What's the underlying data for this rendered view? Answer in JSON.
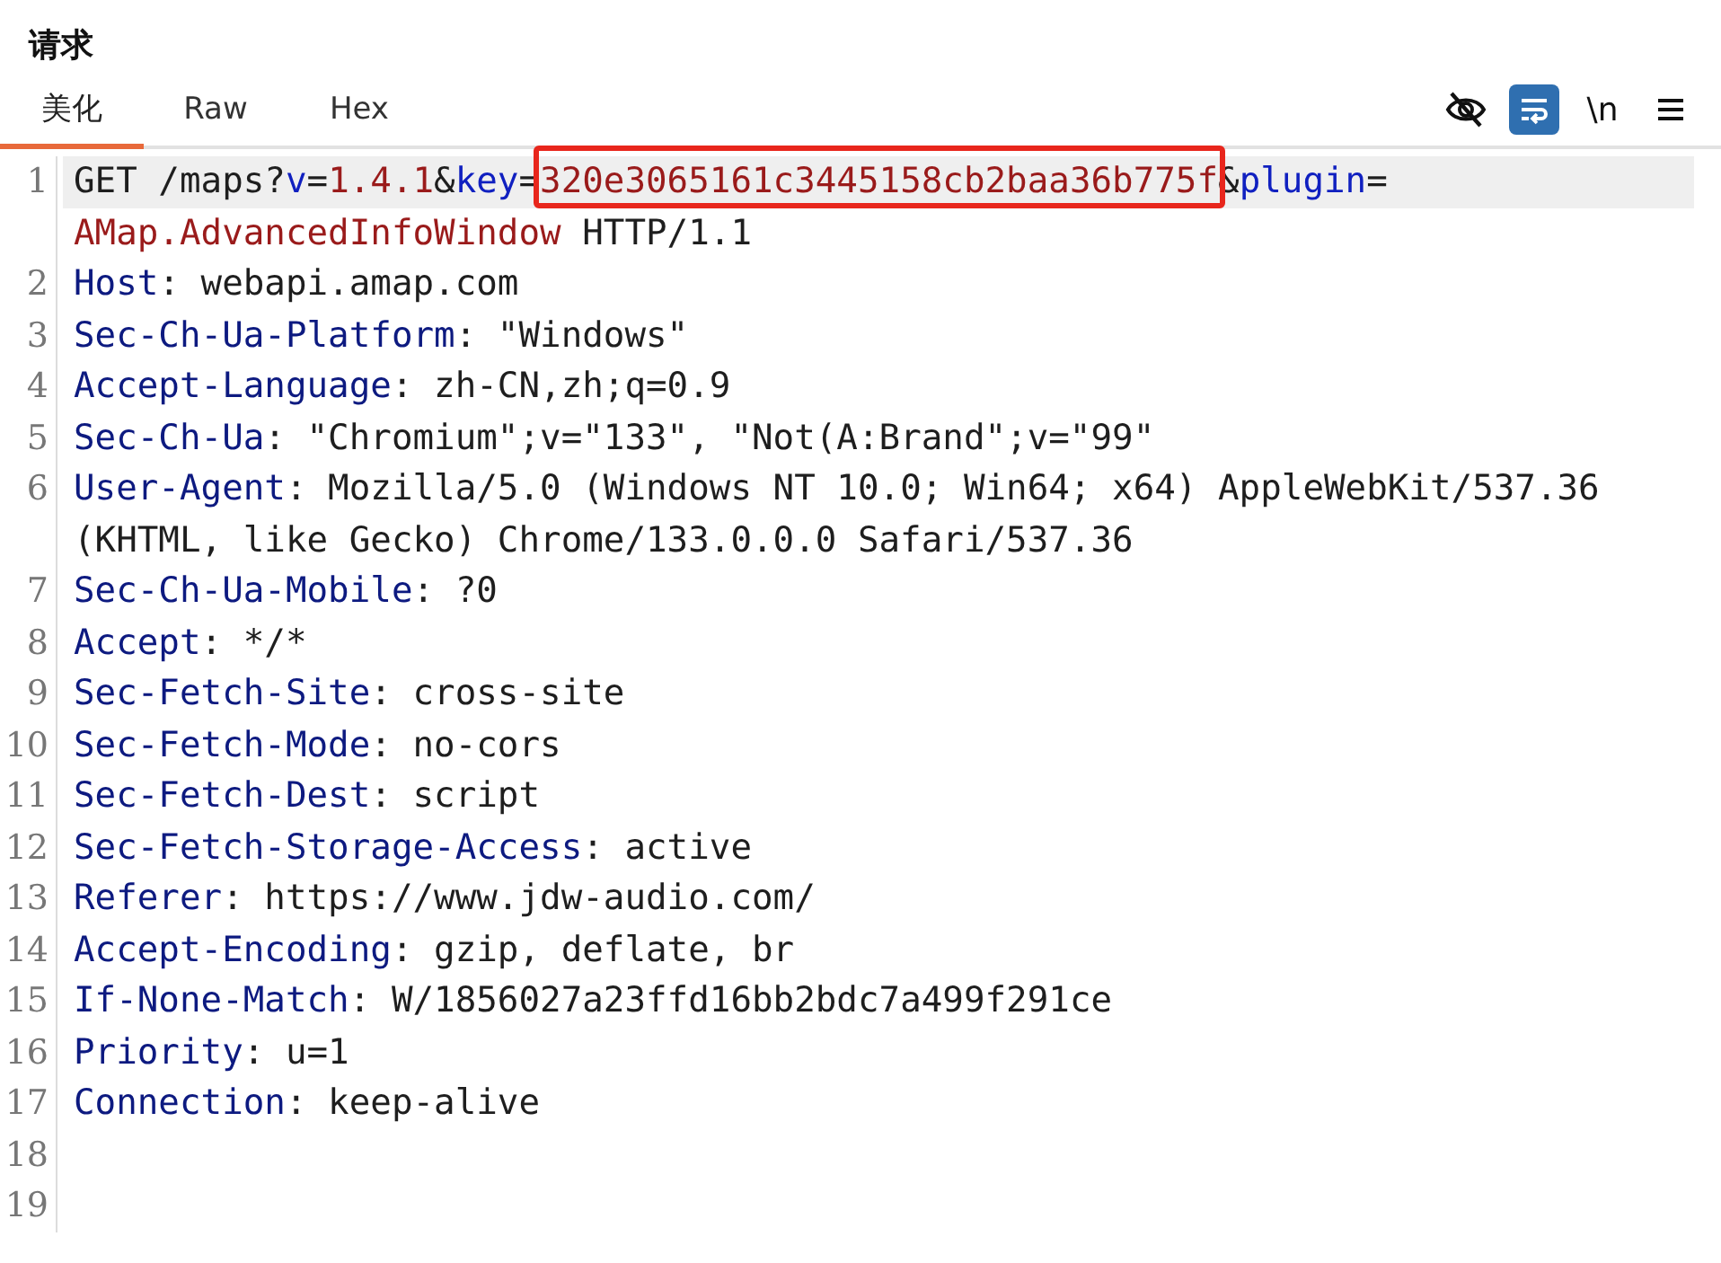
{
  "title": "请求",
  "tabs": [
    {
      "label": "美化",
      "selected": true
    },
    {
      "label": "Raw",
      "selected": false
    },
    {
      "label": "Hex",
      "selected": false
    }
  ],
  "toolbar": [
    {
      "kind": "eye-off",
      "on": false
    },
    {
      "kind": "wrap",
      "on": true
    },
    {
      "kind": "text",
      "label": "\\n",
      "on": false
    },
    {
      "kind": "menu",
      "on": false
    }
  ],
  "lines": [
    {
      "number": "1",
      "current": true,
      "rows": [
        {
          "segments": [
            {
              "kind": "plain",
              "text": "GET /maps?"
            },
            {
              "kind": "param",
              "text": "v"
            },
            {
              "kind": "plain",
              "text": "="
            },
            {
              "kind": "value",
              "text": "1.4.1"
            },
            {
              "kind": "plain",
              "text": "&"
            },
            {
              "kind": "param",
              "text": "key"
            },
            {
              "kind": "plain",
              "text": "="
            },
            {
              "kind": "value",
              "text": "320e3065161c3445158cb2baa36b775f",
              "marked": true
            },
            {
              "kind": "plain",
              "text": "&"
            },
            {
              "kind": "param",
              "text": "plugin"
            },
            {
              "kind": "plain",
              "text": "="
            }
          ]
        },
        {
          "segments": [
            {
              "kind": "value",
              "text": "AMap.AdvancedInfoWindow"
            },
            {
              "kind": "plain",
              "text": " HTTP/1.1"
            }
          ]
        }
      ]
    },
    {
      "number": "2",
      "current": false,
      "rows": [
        {
          "segments": [
            {
              "kind": "name",
              "text": "Host"
            },
            {
              "kind": "plain",
              "text": ": webapi.amap.com"
            }
          ]
        }
      ]
    },
    {
      "number": "3",
      "current": false,
      "rows": [
        {
          "segments": [
            {
              "kind": "name",
              "text": "Sec-Ch-Ua-Platform"
            },
            {
              "kind": "plain",
              "text": ": \"Windows\""
            }
          ]
        }
      ]
    },
    {
      "number": "4",
      "current": false,
      "rows": [
        {
          "segments": [
            {
              "kind": "name",
              "text": "Accept-Language"
            },
            {
              "kind": "plain",
              "text": ": zh-CN,zh;q=0.9"
            }
          ]
        }
      ]
    },
    {
      "number": "5",
      "current": false,
      "rows": [
        {
          "segments": [
            {
              "kind": "name",
              "text": "Sec-Ch-Ua"
            },
            {
              "kind": "plain",
              "text": ": \"Chromium\";v=\"133\", \"Not(A:Brand\";v=\"99\""
            }
          ]
        }
      ]
    },
    {
      "number": "6",
      "current": false,
      "rows": [
        {
          "segments": [
            {
              "kind": "name",
              "text": "User-Agent"
            },
            {
              "kind": "plain",
              "text": ": Mozilla/5.0 (Windows NT 10.0; Win64; x64) AppleWebKit/537.36"
            }
          ]
        },
        {
          "segments": [
            {
              "kind": "plain",
              "text": "(KHTML, like Gecko) Chrome/133.0.0.0 Safari/537.36"
            }
          ]
        }
      ]
    },
    {
      "number": "7",
      "current": false,
      "rows": [
        {
          "segments": [
            {
              "kind": "name",
              "text": "Sec-Ch-Ua-Mobile"
            },
            {
              "kind": "plain",
              "text": ": ?0"
            }
          ]
        }
      ]
    },
    {
      "number": "8",
      "current": false,
      "rows": [
        {
          "segments": [
            {
              "kind": "name",
              "text": "Accept"
            },
            {
              "kind": "plain",
              "text": ": */*"
            }
          ]
        }
      ]
    },
    {
      "number": "9",
      "current": false,
      "rows": [
        {
          "segments": [
            {
              "kind": "name",
              "text": "Sec-Fetch-Site"
            },
            {
              "kind": "plain",
              "text": ": cross-site"
            }
          ]
        }
      ]
    },
    {
      "number": "10",
      "current": false,
      "rows": [
        {
          "segments": [
            {
              "kind": "name",
              "text": "Sec-Fetch-Mode"
            },
            {
              "kind": "plain",
              "text": ": no-cors"
            }
          ]
        }
      ]
    },
    {
      "number": "11",
      "current": false,
      "rows": [
        {
          "segments": [
            {
              "kind": "name",
              "text": "Sec-Fetch-Dest"
            },
            {
              "kind": "plain",
              "text": ": script"
            }
          ]
        }
      ]
    },
    {
      "number": "12",
      "current": false,
      "rows": [
        {
          "segments": [
            {
              "kind": "name",
              "text": "Sec-Fetch-Storage-Access"
            },
            {
              "kind": "plain",
              "text": ": active"
            }
          ]
        }
      ]
    },
    {
      "number": "13",
      "current": false,
      "rows": [
        {
          "segments": [
            {
              "kind": "name",
              "text": "Referer"
            },
            {
              "kind": "plain",
              "text": ": https://www.jdw-audio.com/"
            }
          ]
        }
      ]
    },
    {
      "number": "14",
      "current": false,
      "rows": [
        {
          "segments": [
            {
              "kind": "name",
              "text": "Accept-Encoding"
            },
            {
              "kind": "plain",
              "text": ": gzip, deflate, br"
            }
          ]
        }
      ]
    },
    {
      "number": "15",
      "current": false,
      "rows": [
        {
          "segments": [
            {
              "kind": "name",
              "text": "If-None-Match"
            },
            {
              "kind": "plain",
              "text": ": W/1856027a23ffd16bb2bdc7a499f291ce"
            }
          ]
        }
      ]
    },
    {
      "number": "16",
      "current": false,
      "rows": [
        {
          "segments": [
            {
              "kind": "name",
              "text": "Priority"
            },
            {
              "kind": "plain",
              "text": ": u=1"
            }
          ]
        }
      ]
    },
    {
      "number": "17",
      "current": false,
      "rows": [
        {
          "segments": [
            {
              "kind": "name",
              "text": "Connection"
            },
            {
              "kind": "plain",
              "text": ": keep-alive"
            }
          ]
        }
      ]
    },
    {
      "number": "18",
      "current": false
    },
    {
      "number": "19",
      "current": false
    }
  ]
}
